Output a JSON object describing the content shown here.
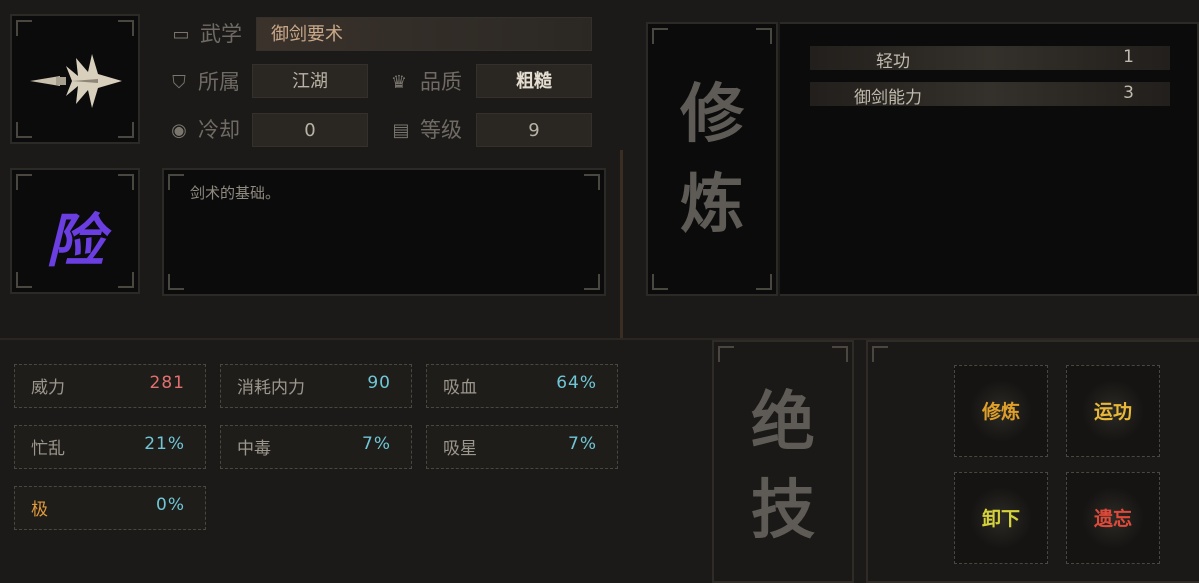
{
  "skill_icon": "sword-icon",
  "danger_glyph": "险",
  "info": {
    "wuxue_label": "武学",
    "wuxue_value": "御剑要术",
    "suoshu_label": "所属",
    "suoshu_value": "江湖",
    "pinzhi_label": "品质",
    "pinzhi_value": "粗糙",
    "lengque_label": "冷却",
    "lengque_value": "0",
    "dengji_label": "等级",
    "dengji_value": "9"
  },
  "description": "剑术的基础。",
  "xiulian": {
    "char1": "修",
    "char2": "炼"
  },
  "requirements": [
    {
      "name": "轻功",
      "value": "1"
    },
    {
      "name": "御剑能力",
      "value": "3"
    }
  ],
  "stats": [
    {
      "name": "威力",
      "value": "281",
      "color": "#e07070"
    },
    {
      "name": "消耗内力",
      "value": "90",
      "color": "#6fc6d6"
    },
    {
      "name": "吸血",
      "value": "64%",
      "color": "#6fc6d6"
    },
    {
      "name": "忙乱",
      "value": "21%",
      "color": "#6fc6d6"
    },
    {
      "name": "中毒",
      "value": "7%",
      "color": "#6fc6d6"
    },
    {
      "name": "吸星",
      "value": "7%",
      "color": "#6fc6d6"
    },
    {
      "name": "极",
      "value": "0%",
      "color": "#6fc6d6",
      "name_color": "#e09a3a"
    }
  ],
  "juezhi": {
    "char1": "绝",
    "char2": "技"
  },
  "actions": [
    {
      "label": "修炼",
      "color": "#e0a028"
    },
    {
      "label": "运功",
      "color": "#e8b838"
    },
    {
      "label": "卸下",
      "color": "#d6d23a"
    },
    {
      "label": "遗忘",
      "color": "#e04a3a"
    }
  ]
}
